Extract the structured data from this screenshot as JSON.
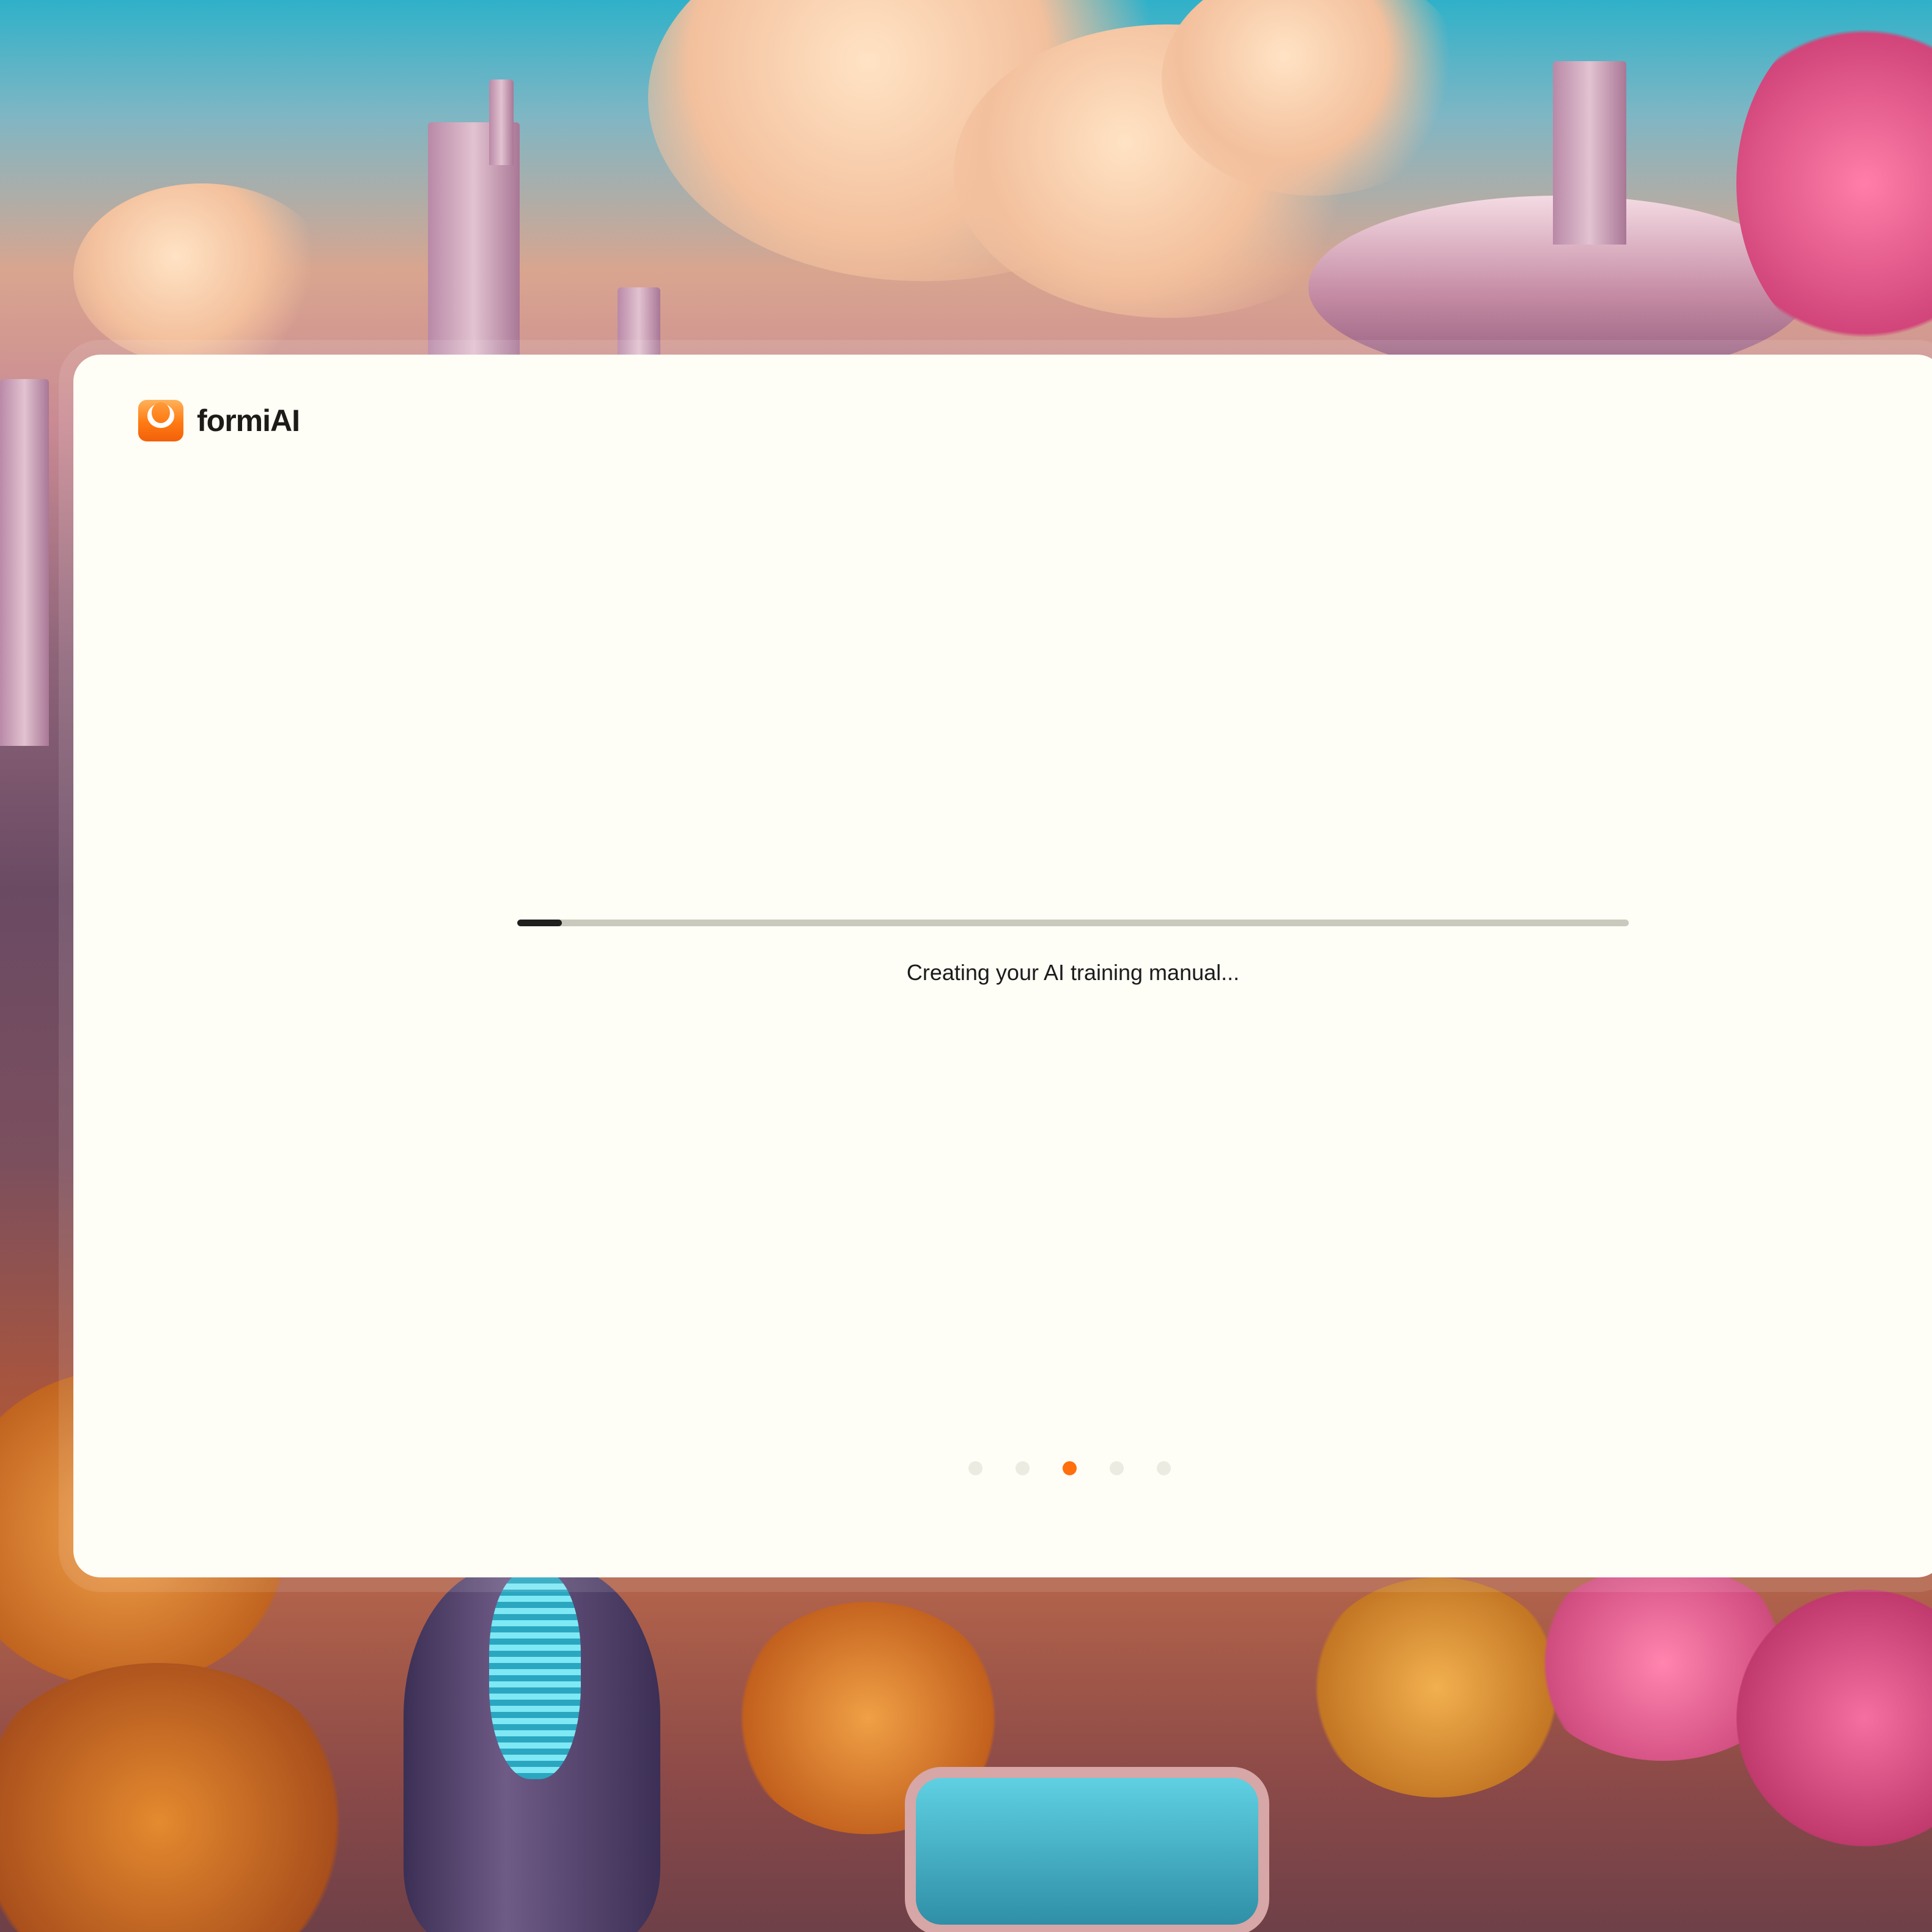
{
  "brand": {
    "name": "formiAI",
    "logo_icon": "formi-logo-icon",
    "accent_color": "#ff6f0c"
  },
  "loader": {
    "status_text": "Creating your AI training manual...",
    "progress_fraction": 0.04
  },
  "pagination": {
    "count": 5,
    "active_index": 2,
    "active_color": "#ff6f0c",
    "inactive_color": "#ecebe2"
  }
}
